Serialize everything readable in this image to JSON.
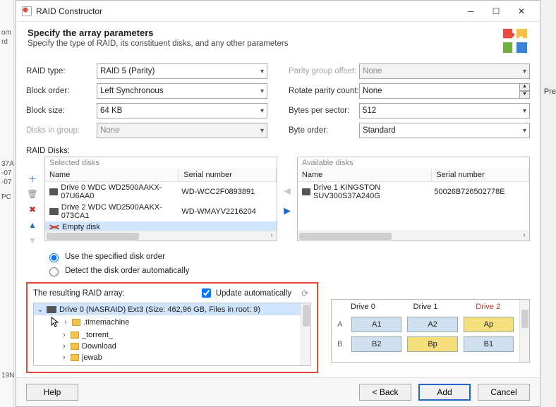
{
  "window_title": "RAID Constructor",
  "header": {
    "title": "Specify the array parameters",
    "subtitle": "Specify the type of RAID, its constituent disks, and any other parameters"
  },
  "left_form": {
    "raid_type": {
      "label": "RAID type:",
      "value": "RAID 5 (Parity)"
    },
    "block_order": {
      "label": "Block order:",
      "value": "Left Synchronous"
    },
    "block_size": {
      "label": "Block size:",
      "value": "64 KB"
    },
    "disks_in_group": {
      "label": "Disks in group:",
      "value": "None"
    }
  },
  "right_form": {
    "parity_offset": {
      "label": "Parity group offset:",
      "value": "None"
    },
    "rotate_parity": {
      "label": "Rotate parity count:",
      "value": "None"
    },
    "bytes_per_sector": {
      "label": "Bytes per sector:",
      "value": "512"
    },
    "byte_order": {
      "label": "Byte order:",
      "value": "Standard"
    }
  },
  "raid_disks_label": "RAID Disks:",
  "selected_panel": {
    "caption": "Selected disks",
    "col_name": "Name",
    "col_serial": "Serial number",
    "rows": [
      {
        "name": "Drive 0 WDC WD2500AAKX-07U6AA0",
        "serial": "WD-WCC2F0893891"
      },
      {
        "name": "Drive 2 WDC WD2500AAKX-073CA1",
        "serial": "WD-WMAYV2216204"
      },
      {
        "name": "Empty disk",
        "serial": "",
        "empty": true
      }
    ]
  },
  "available_panel": {
    "caption": "Available disks",
    "col_name": "Name",
    "col_serial": "Serial number",
    "rows": [
      {
        "name": "Drive 1 KINGSTON SUV300S37A240G",
        "serial": "50026B726502778E"
      }
    ]
  },
  "order_options": {
    "use_specified": "Use the specified disk order",
    "detect_auto": "Detect the disk order automatically"
  },
  "resulting": {
    "label": "The resulting RAID array:",
    "update_auto": "Update automatically",
    "root": "Drive 0 (NASRAID) Ext3 (Size: 462,96 GB, Files in root: 9)",
    "folders": [
      ".timemachine",
      "_torrent_",
      "Download",
      "jewab"
    ]
  },
  "stripemap": {
    "headers": [
      "Drive 0",
      "Drive 1",
      "Drive 2"
    ],
    "rowA": {
      "label": "A",
      "cells": [
        "A1",
        "A2",
        "Ap"
      ],
      "par_index": 2
    },
    "rowB": {
      "label": "B",
      "cells": [
        "B2",
        "Bp",
        "B1"
      ],
      "par_index": 1
    }
  },
  "footer": {
    "help": "Help",
    "back": "< Back",
    "add": "Add",
    "cancel": "Cancel"
  },
  "side_frags": [
    "om",
    "rd",
    "37A",
    "-07",
    "-07",
    "PC",
    "19N"
  ],
  "right_frag": "Pre"
}
